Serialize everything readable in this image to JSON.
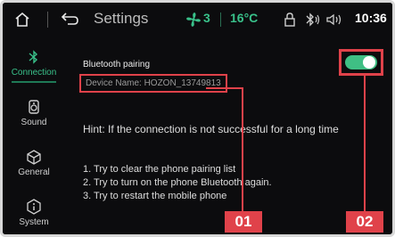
{
  "statusbar": {
    "title": "Settings",
    "fan_level": "3",
    "temperature": "16°C",
    "time": "10:36",
    "icons": [
      "home-icon",
      "back-icon",
      "fan-icon",
      "lock-icon",
      "bluetooth-icon",
      "volume-icon"
    ]
  },
  "sidebar": {
    "items": [
      {
        "label": "Connection",
        "icon": "bluetooth-icon",
        "active": true
      },
      {
        "label": "Sound",
        "icon": "speaker-icon",
        "active": false
      },
      {
        "label": "General",
        "icon": "cube-icon",
        "active": false
      },
      {
        "label": "System",
        "icon": "info-icon",
        "active": false
      }
    ]
  },
  "content": {
    "bluetooth_label": "Bluetooth pairing",
    "device_name": "Device Name: HOZON_13749813",
    "toggle_on": true,
    "hint": "Hint: If the connection is not successful for a long time",
    "steps": [
      "1. Try to clear the phone pairing list",
      "2. Try to turn on the phone Bluetooth again.",
      "3. Try to restart the mobile phone"
    ]
  },
  "markers": [
    "01",
    "02"
  ],
  "colors": {
    "accent": "#39c18a",
    "annotation": "#e0424a",
    "background": "#0c0c0e"
  }
}
